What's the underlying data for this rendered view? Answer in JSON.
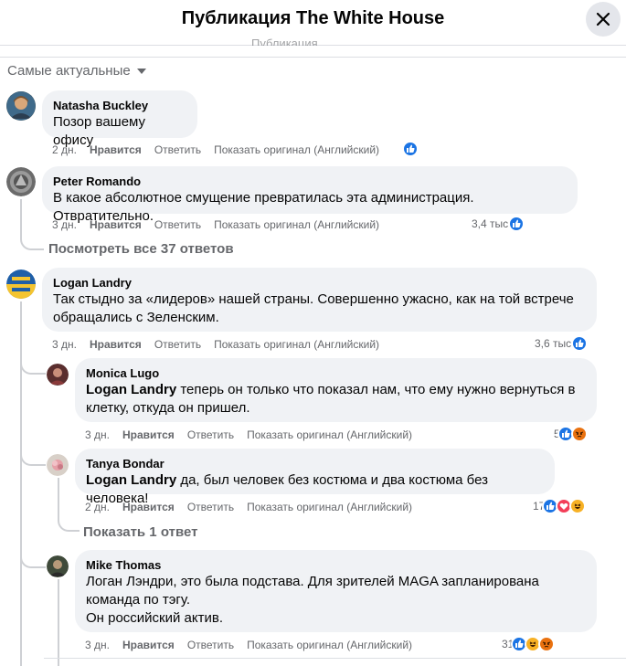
{
  "header": {
    "title": "Публикация The White House",
    "ghost": "Публикация"
  },
  "sort": {
    "label": "Самые актуальные"
  },
  "comments": [
    {
      "author": "Natasha Buckley",
      "text": "Позор вашему офису",
      "time": "2 дн.",
      "like": "Нравится",
      "reply": "Ответить",
      "translate": "Показать оригинал (Английский)",
      "reactions": "",
      "reaction_icons": [
        "like"
      ]
    },
    {
      "author": "Peter Romando",
      "text": "В какое абсолютное смущение превратилась эта администрация. Отвратительно.",
      "time": "3 дн.",
      "like": "Нравится",
      "reply": "Ответить",
      "translate": "Показать оригинал (Английский)",
      "reactions": "3,4 тыс.",
      "reaction_icons": [
        "like"
      ]
    },
    {
      "author": "Logan Landry",
      "text_line1": "Так стыдно за «лидеров» нашей страны. Совершенно ужасно, как на той встрече",
      "text_line2": "обращались с Зеленским.",
      "time": "3 дн.",
      "like": "Нравится",
      "reply": "Ответить",
      "translate": "Показать оригинал (Английский)",
      "reactions": "3,6 тыс.",
      "reaction_icons": [
        "like"
      ]
    }
  ],
  "view_replies": "Посмотреть все 37 ответов",
  "replies": [
    {
      "author": "Monica Lugo",
      "mention": "Logan Landry",
      "text_line1": " теперь он только что показал нам, что ему нужно вернуться в",
      "text_line2": "клетку, откуда он пришел.",
      "time": "3 дн.",
      "like": "Нравится",
      "reply": "Ответить",
      "translate": "Показать оригинал (Английский)",
      "reactions": "5",
      "reaction_icons": [
        "like",
        "angry"
      ]
    },
    {
      "author": "Tanya Bondar",
      "mention": "Logan Landry",
      "text_line1": " да, был человек без костюма и два костюма без человека!",
      "time": "2 дн.",
      "like": "Нравится",
      "reply": "Ответить",
      "translate": "Показать оригинал (Английский)",
      "reactions": "17",
      "reaction_icons": [
        "like",
        "love",
        "haha"
      ]
    },
    {
      "author": "Mike Thomas",
      "text_line1": "Логан Лэндри, это была подстава. Для зрителей MAGA запланирована",
      "text_line2": "команда по тэгу.",
      "text_line3": "Он российский актив.",
      "time": "3 дн.",
      "like": "Нравится",
      "reply": "Ответить",
      "translate": "Показать оригинал (Английский)",
      "reactions": "31",
      "reaction_icons": [
        "like",
        "haha",
        "angry"
      ]
    }
  ],
  "show_reply": "Показать 1 ответ",
  "colors": {
    "accent": "#1b74e4",
    "bubble": "#f0f2f5",
    "muted": "#65676b"
  },
  "icons": {
    "close": "close-icon",
    "sort": "caret-down-icon",
    "like": "like-icon",
    "love": "love-icon",
    "haha": "haha-icon",
    "angry": "angry-icon"
  }
}
